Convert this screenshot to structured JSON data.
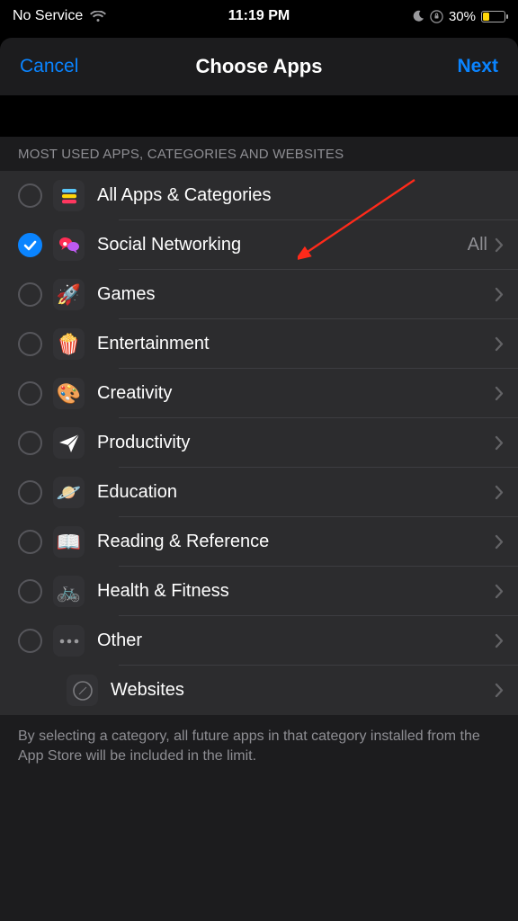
{
  "status": {
    "carrier": "No Service",
    "time": "11:19 PM",
    "battery_pct": "30%",
    "battery_fill": 30,
    "battery_color": "#ffd60a"
  },
  "nav": {
    "cancel": "Cancel",
    "title": "Choose Apps",
    "next": "Next"
  },
  "section_title": "MOST USED APPS, CATEGORIES AND WEBSITES",
  "rows": [
    {
      "icon": "stacks-icon",
      "glyph": "stacks",
      "label": "All Apps & Categories",
      "checked": false,
      "chevron": false,
      "sub": false
    },
    {
      "icon": "social-icon",
      "glyph": "social",
      "label": "Social Networking",
      "checked": true,
      "chevron": true,
      "trail": "All",
      "sub": false
    },
    {
      "icon": "rocket-icon",
      "glyph": "🚀",
      "label": "Games",
      "checked": false,
      "chevron": true,
      "sub": false
    },
    {
      "icon": "popcorn-icon",
      "glyph": "🍿",
      "label": "Entertainment",
      "checked": false,
      "chevron": true,
      "sub": false
    },
    {
      "icon": "palette-icon",
      "glyph": "🎨",
      "label": "Creativity",
      "checked": false,
      "chevron": true,
      "sub": false
    },
    {
      "icon": "plane-icon",
      "glyph": "plane",
      "label": "Productivity",
      "checked": false,
      "chevron": true,
      "sub": false
    },
    {
      "icon": "planet-icon",
      "glyph": "🪐",
      "label": "Education",
      "checked": false,
      "chevron": true,
      "sub": false
    },
    {
      "icon": "book-icon",
      "glyph": "📖",
      "label": "Reading & Reference",
      "checked": false,
      "chevron": true,
      "sub": false
    },
    {
      "icon": "bike-icon",
      "glyph": "🚲",
      "label": "Health & Fitness",
      "checked": false,
      "chevron": true,
      "sub": false
    },
    {
      "icon": "ellipsis-icon",
      "glyph": "ellipsis",
      "label": "Other",
      "checked": false,
      "chevron": true,
      "sub": false
    },
    {
      "icon": "compass-icon",
      "glyph": "compass",
      "label": "Websites",
      "checked": null,
      "chevron": true,
      "sub": true
    }
  ],
  "footer": "By selecting a category, all future apps in that category installed from the App Store will be included in the limit."
}
